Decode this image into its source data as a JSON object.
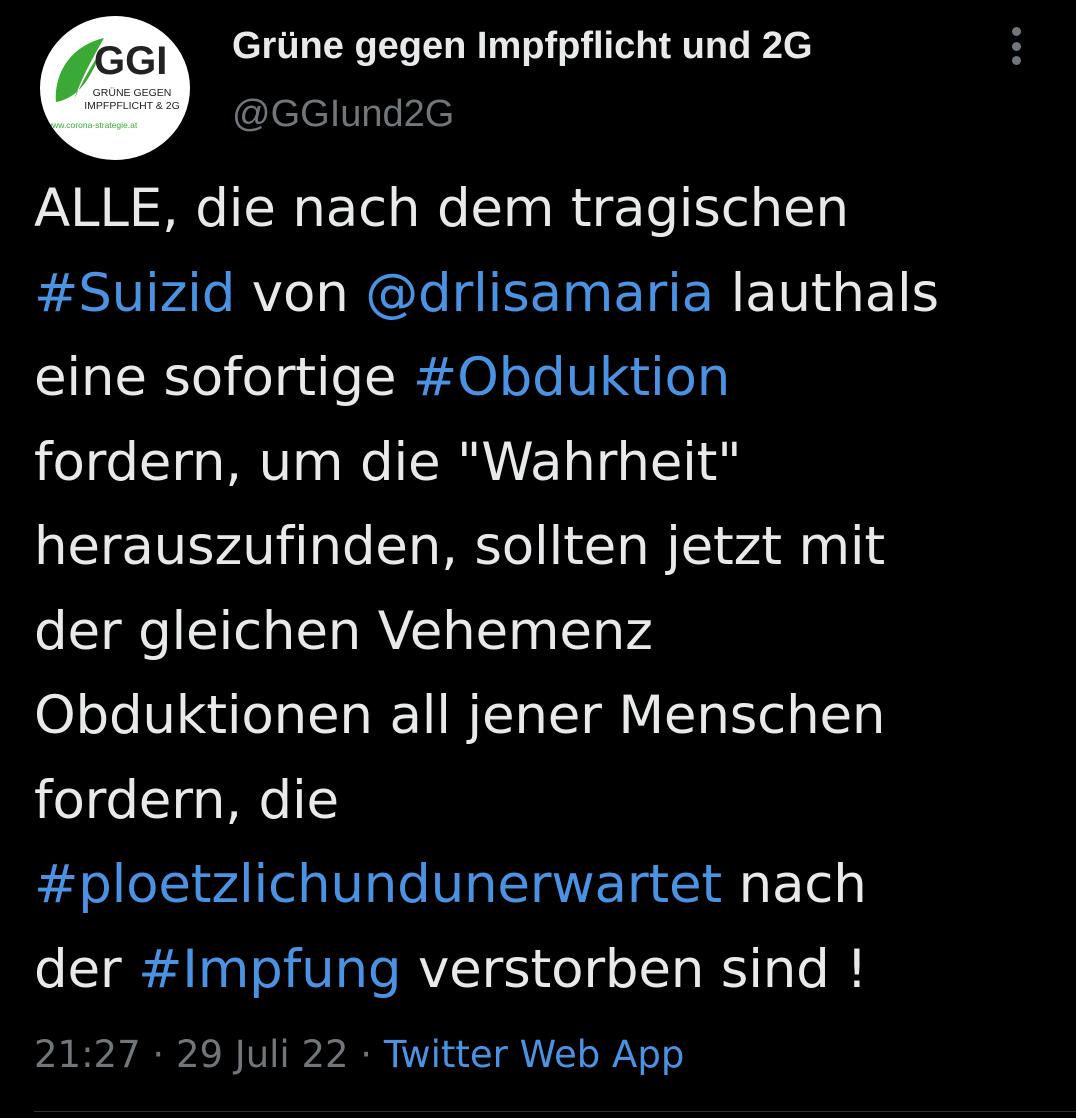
{
  "author": {
    "display_name": "Grüne gegen Impfpflicht und 2G",
    "handle": "@GGIund2G",
    "avatar": {
      "logo_text": "GGI",
      "line1": "GRÜNE GEGEN",
      "line2": "IMPFPFLICHT & 2G",
      "url": "www.corona-strategie.at",
      "leaf_color": "#3aa935"
    }
  },
  "more_icon": "more-vertical-icon",
  "tweet": {
    "lines": [
      [
        {
          "t": "ALLE, die nach dem tragischen",
          "link": false
        }
      ],
      [
        {
          "t": "#Suizid",
          "link": true
        },
        {
          "t": " von ",
          "link": false
        },
        {
          "t": "@drlisamaria",
          "link": true
        },
        {
          "t": " lauthals",
          "link": false
        }
      ],
      [
        {
          "t": "eine sofortige ",
          "link": false
        },
        {
          "t": "#Obduktion",
          "link": true
        }
      ],
      [
        {
          "t": "fordern, um die \"Wahrheit\"",
          "link": false
        }
      ],
      [
        {
          "t": "herauszufinden, sollten jetzt mit",
          "link": false
        }
      ],
      [
        {
          "t": "der gleichen Vehemenz",
          "link": false
        }
      ],
      [
        {
          "t": "Obduktionen all jener Menschen",
          "link": false
        }
      ],
      [
        {
          "t": "fordern, die",
          "link": false
        }
      ],
      [
        {
          "t": "#ploetzlichundunerwartet",
          "link": true
        },
        {
          "t": " nach",
          "link": false
        }
      ],
      [
        {
          "t": "der ",
          "link": false
        },
        {
          "t": "#Impfung",
          "link": true
        },
        {
          "t": " verstorben sind !",
          "link": false
        }
      ]
    ]
  },
  "meta": {
    "time": "21:27",
    "sep1": " · ",
    "date": "29 Juli 22",
    "sep2": " · ",
    "source": "Twitter Web App"
  },
  "colors": {
    "background": "#000000",
    "text": "#e7e9ea",
    "secondary": "#71767b",
    "link": "#4a93e3"
  }
}
